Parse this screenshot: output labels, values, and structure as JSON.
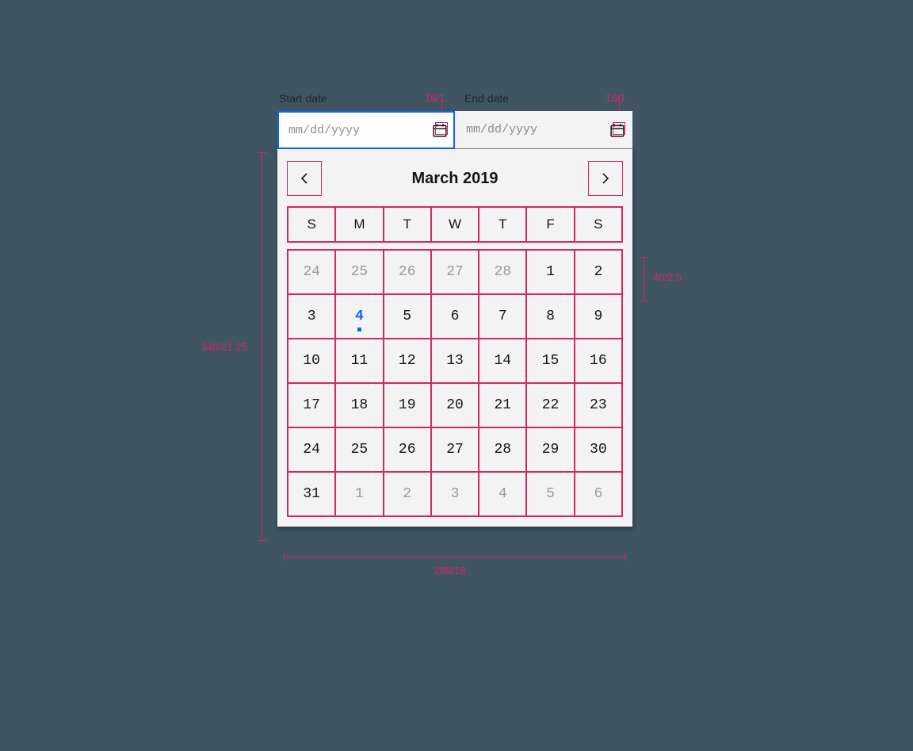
{
  "labels": {
    "start": "Start date",
    "end": "End date"
  },
  "inputs": {
    "start_placeholder": "mm/dd/yyyy",
    "end_placeholder": "mm/dd/yyyy",
    "start_value": "",
    "end_value": ""
  },
  "annotations": {
    "icon_start": "16/1",
    "icon_end": "16/1",
    "height": "340/21.25",
    "width": "288/18",
    "row_height": "40/2.5"
  },
  "calendar": {
    "month_label": "March  2019",
    "dow": [
      "S",
      "M",
      "T",
      "W",
      "T",
      "F",
      "S"
    ],
    "today": 4,
    "weeks": [
      [
        {
          "d": 24,
          "out": true
        },
        {
          "d": 25,
          "out": true
        },
        {
          "d": 26,
          "out": true
        },
        {
          "d": 27,
          "out": true
        },
        {
          "d": 28,
          "out": true
        },
        {
          "d": 1
        },
        {
          "d": 2
        }
      ],
      [
        {
          "d": 3
        },
        {
          "d": 4,
          "today": true
        },
        {
          "d": 5
        },
        {
          "d": 6
        },
        {
          "d": 7
        },
        {
          "d": 8
        },
        {
          "d": 9
        }
      ],
      [
        {
          "d": 10
        },
        {
          "d": 11
        },
        {
          "d": 12
        },
        {
          "d": 13
        },
        {
          "d": 14
        },
        {
          "d": 15
        },
        {
          "d": 16
        }
      ],
      [
        {
          "d": 17
        },
        {
          "d": 18
        },
        {
          "d": 19
        },
        {
          "d": 20
        },
        {
          "d": 21
        },
        {
          "d": 22
        },
        {
          "d": 23
        }
      ],
      [
        {
          "d": 24
        },
        {
          "d": 25
        },
        {
          "d": 26
        },
        {
          "d": 27
        },
        {
          "d": 28
        },
        {
          "d": 29
        },
        {
          "d": 30
        }
      ],
      [
        {
          "d": 31
        },
        {
          "d": 1,
          "out": true
        },
        {
          "d": 2,
          "out": true
        },
        {
          "d": 3,
          "out": true
        },
        {
          "d": 4,
          "out": true
        },
        {
          "d": 5,
          "out": true
        },
        {
          "d": 6,
          "out": true
        }
      ]
    ]
  },
  "colors": {
    "spec": "#d12765",
    "focus": "#0f62fe",
    "bg": "#405562"
  }
}
